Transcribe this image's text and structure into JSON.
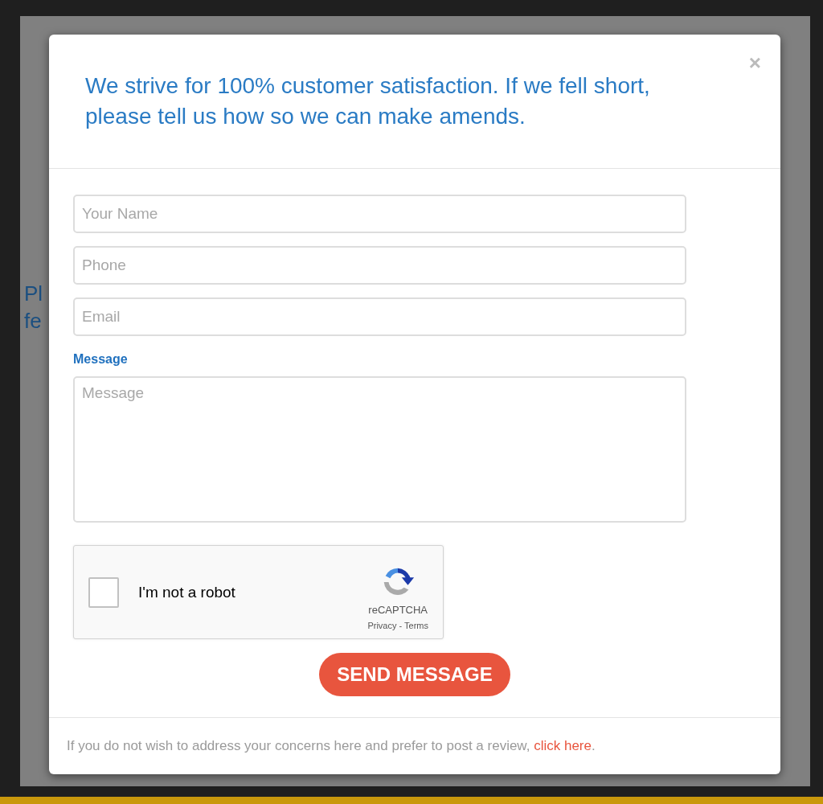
{
  "background_text": [
    "Pl",
    "fe"
  ],
  "modal": {
    "close": "×",
    "heading": "We strive for 100% customer satisfaction. If we fell short, please tell us how so we can make amends.",
    "fields": [
      {
        "placeholder": "Your Name"
      },
      {
        "placeholder": "Phone"
      },
      {
        "placeholder": "Email"
      }
    ],
    "message_label": "Message",
    "message": {
      "placeholder": "Message"
    },
    "captcha": {
      "checked": false,
      "label": "I'm not a robot",
      "brand": "reCAPTCHA",
      "links": "Privacy - Terms"
    },
    "submit": "SEND MESSAGE",
    "footer": {
      "text": "If you do not wish to address your concerns here and prefer to post a review,",
      "link": "click here",
      "end": "."
    }
  }
}
